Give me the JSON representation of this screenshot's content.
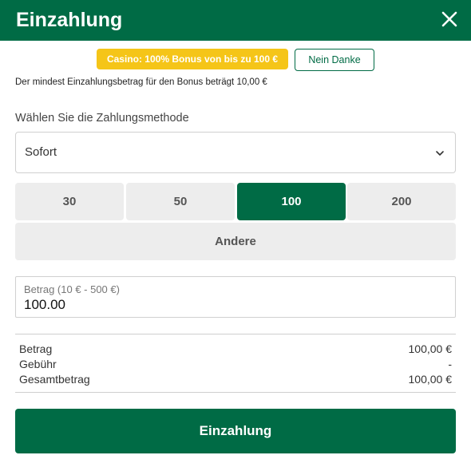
{
  "header": {
    "title": "Einzahlung",
    "close_icon": "close-icon"
  },
  "bonus": {
    "promo_label": "Casino: 100% Bonus von bis zu 100 €",
    "decline_label": "Nein Danke",
    "note": "Der mindest Einzahlungsbetrag für den Bonus beträgt 10,00 €"
  },
  "payment_method": {
    "label": "Wählen Sie die Zahlungsmethode",
    "selected": "Sofort",
    "dropdown_icon": "chevron-down-icon"
  },
  "quick_amounts": {
    "options": [
      "30",
      "50",
      "100",
      "200"
    ],
    "selected": "100",
    "other_label": "Andere"
  },
  "amount_field": {
    "label": "Betrag (10 € - 500 €)",
    "value": "100.00"
  },
  "summary": {
    "rows": [
      {
        "label": "Betrag",
        "value": "100,00 €"
      },
      {
        "label": "Gebühr",
        "value": "-"
      },
      {
        "label": "Gesamtbetrag",
        "value": "100,00 €"
      }
    ]
  },
  "submit_label": "Einzahlung",
  "colors": {
    "brand": "#006B45",
    "promo": "#F5C518",
    "button_bg": "#EDEDED"
  }
}
